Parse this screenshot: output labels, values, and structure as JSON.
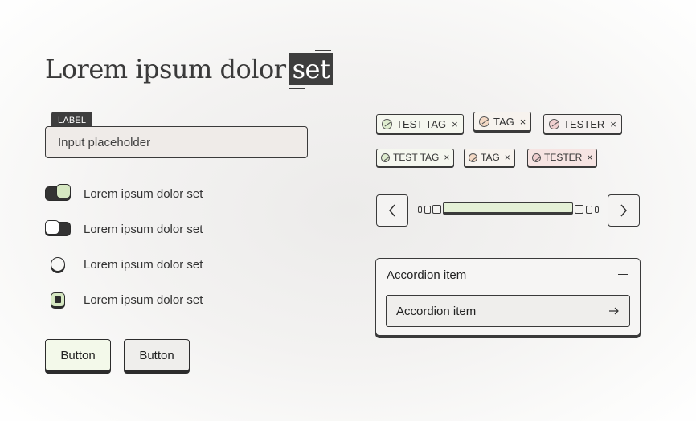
{
  "title": {
    "text": "Lorem ipsum dolor",
    "highlight": "set"
  },
  "input": {
    "label": "LABEL",
    "placeholder": "Input placeholder"
  },
  "options": [
    {
      "control": "toggle",
      "state": "on",
      "label": "Lorem ipsum dolor set"
    },
    {
      "control": "toggle",
      "state": "off",
      "label": "Lorem ipsum dolor set"
    },
    {
      "control": "radio",
      "state": "unchecked",
      "label": "Lorem ipsum dolor set"
    },
    {
      "control": "checkbox",
      "state": "checked",
      "label": "Lorem ipsum dolor set"
    }
  ],
  "buttons": {
    "primary": "Button",
    "secondary": "Button"
  },
  "tags": {
    "large": [
      {
        "label": "TEST TAG",
        "color": "green",
        "close": "×"
      },
      {
        "label": "TAG",
        "color": "orange",
        "close": "×"
      },
      {
        "label": "TESTER",
        "color": "red",
        "close": "×"
      }
    ],
    "small": [
      {
        "label": "TEST TAG",
        "color": "green",
        "close": "×"
      },
      {
        "label": "TAG",
        "color": "orange",
        "close": "×"
      },
      {
        "label": "TESTER",
        "color": "red",
        "close": "×"
      }
    ]
  },
  "pager": {
    "prev_icon": "chevron-left-icon",
    "next_icon": "chevron-right-icon",
    "segments": 7,
    "active_segment": 4
  },
  "accordion": {
    "header": "Accordion item",
    "item": "Accordion item",
    "collapse_icon": "minus-icon",
    "item_icon": "arrow-right-icon"
  },
  "colors": {
    "ink": "#2c2c2c",
    "accent_green": "#d6e8c2",
    "tag_orange": "#f4d9c4",
    "tag_red": "#f0cfcf"
  }
}
